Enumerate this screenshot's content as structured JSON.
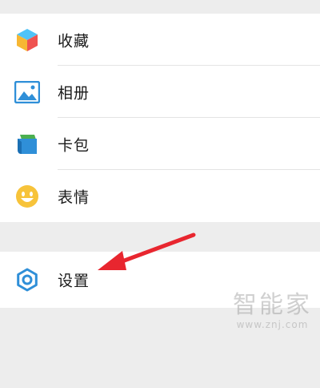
{
  "menu": {
    "items": [
      {
        "label": "收藏",
        "icon": "favorites-cube-icon"
      },
      {
        "label": "相册",
        "icon": "album-picture-icon"
      },
      {
        "label": "卡包",
        "icon": "card-wallet-icon"
      },
      {
        "label": "表情",
        "icon": "sticker-smiley-icon"
      }
    ],
    "settings": {
      "label": "设置",
      "icon": "settings-gear-icon"
    }
  },
  "watermark": {
    "main": "智能家",
    "sub": "www.znj.com"
  },
  "colors": {
    "arrow": "#e8262f",
    "icon_blue": "#2f8fd8",
    "icon_yellow": "#f7c33a"
  }
}
